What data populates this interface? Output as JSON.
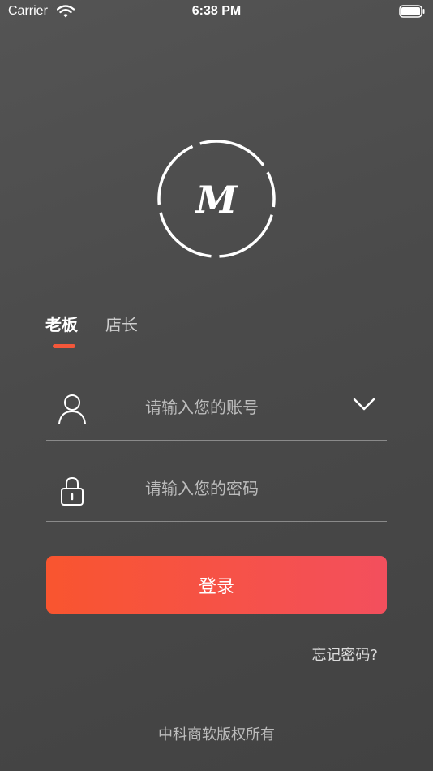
{
  "status_bar": {
    "carrier": "Carrier",
    "time": "6:38 PM",
    "wifi_icon": "wifi-icon",
    "battery_icon": "battery-icon"
  },
  "logo": {
    "letter": "M",
    "icon": "dashed-circle-logo"
  },
  "tabs": [
    {
      "label": "老板",
      "selected": true
    },
    {
      "label": "店长",
      "selected": false
    }
  ],
  "form": {
    "account": {
      "placeholder": "请输入您的账号",
      "value": "",
      "icon": "user-icon",
      "dropdown_icon": "chevron-down-icon"
    },
    "password": {
      "placeholder": "请输入您的密码",
      "value": "",
      "icon": "lock-icon"
    }
  },
  "login_button": "登录",
  "forgot_password": "忘记密码?",
  "footer": "中科商软版权所有",
  "colors": {
    "accent": "#f4573a",
    "button_gradient_start": "#f9552f",
    "button_gradient_end": "#f34f5d",
    "background": "#4a4a4a"
  }
}
